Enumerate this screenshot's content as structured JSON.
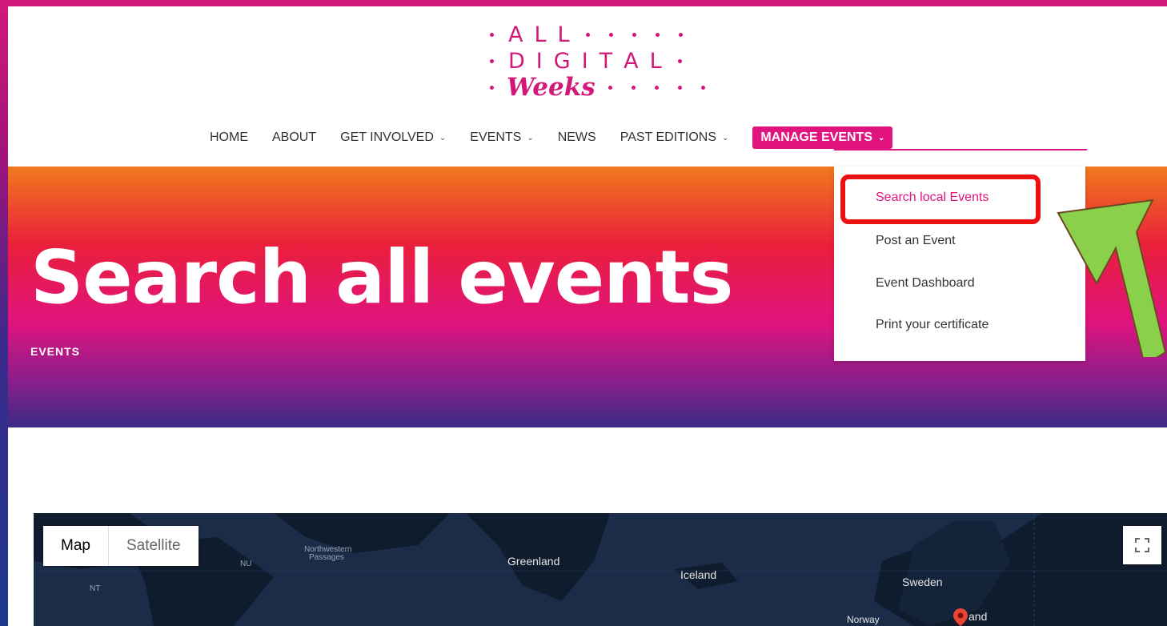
{
  "logo": {
    "row1": [
      "A",
      "L",
      "L"
    ],
    "row2": [
      "D",
      "I",
      "G",
      "I",
      "T",
      "A",
      "L"
    ],
    "weeks": "Weeks"
  },
  "nav": {
    "items": [
      {
        "label": "HOME",
        "has_dropdown": false
      },
      {
        "label": "ABOUT",
        "has_dropdown": false
      },
      {
        "label": "GET INVOLVED",
        "has_dropdown": true
      },
      {
        "label": "EVENTS",
        "has_dropdown": true
      },
      {
        "label": "NEWS",
        "has_dropdown": false
      },
      {
        "label": "PAST EDITIONS",
        "has_dropdown": true
      }
    ],
    "active": {
      "label": "MANAGE EVENTS"
    }
  },
  "dropdown": {
    "items": [
      "Search local Events",
      "Post an Event",
      "Event Dashboard",
      "Print your certificate"
    ]
  },
  "hero": {
    "title": "Search all events",
    "breadcrumb": "EVENTS"
  },
  "map": {
    "type_map": "Map",
    "type_satellite": "Satellite",
    "labels": {
      "nu": "NU",
      "nt": "NT",
      "passages_1": "Northwestern",
      "passages_2": "Passages",
      "greenland": "Greenland",
      "iceland": "Iceland",
      "sweden": "Sweden",
      "norway": "Norway",
      "finland": "and"
    }
  },
  "colors": {
    "brand": "#e0137f",
    "highlight_box": "#ee1111",
    "arrow_fill": "#8bd04a",
    "map_bg": "#1a2c48"
  }
}
